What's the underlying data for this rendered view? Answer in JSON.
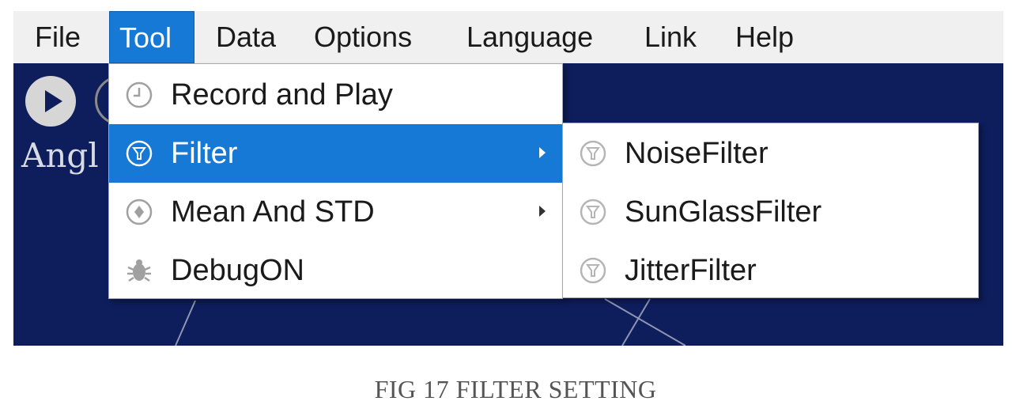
{
  "menubar": {
    "items": [
      {
        "label": "File"
      },
      {
        "label": "Tool",
        "active": true
      },
      {
        "label": "Data"
      },
      {
        "label": "Options"
      },
      {
        "label": "Language"
      },
      {
        "label": "Link"
      },
      {
        "label": "Help"
      }
    ]
  },
  "app": {
    "angle_label": "Angl"
  },
  "tool_menu": {
    "items": [
      {
        "label": "Record and Play",
        "icon": "clock-icon"
      },
      {
        "label": "Filter",
        "icon": "filter-icon",
        "highlighted": true,
        "submenu": true
      },
      {
        "label": "Mean And STD",
        "icon": "plus-circle-icon",
        "submenu": true
      },
      {
        "label": "DebugON",
        "icon": "bug-icon"
      }
    ]
  },
  "filter_submenu": {
    "items": [
      {
        "label": "NoiseFilter",
        "icon": "filter-icon"
      },
      {
        "label": "SunGlassFilter",
        "icon": "filter-icon"
      },
      {
        "label": "JitterFilter",
        "icon": "filter-icon"
      }
    ]
  },
  "caption": "FIG 17 FILTER SETTING",
  "colors": {
    "menu_highlight": "#1779d6",
    "app_background": "#0e1d5c",
    "menubar_background": "#f0f0f0"
  }
}
